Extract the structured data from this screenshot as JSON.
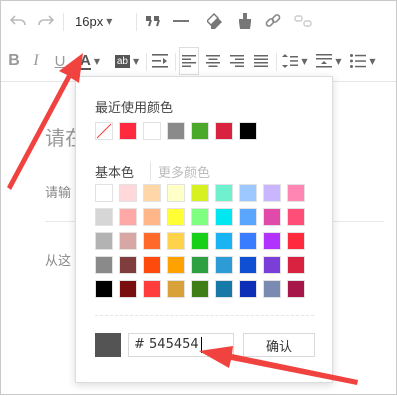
{
  "toolbar": {
    "font_size": "16px",
    "icons_row1": [
      "undo-icon",
      "redo-icon",
      "font-size-select",
      "quote-icon",
      "horizontal-rule-icon",
      "eraser-icon",
      "format-brush-icon",
      "link-icon",
      "unlink-icon"
    ],
    "icons_row2": [
      "bold-icon",
      "italic-icon",
      "underline-icon",
      "font-color-icon",
      "background-color-icon",
      "indent-icon",
      "align-left-icon",
      "align-center-icon",
      "align-right-icon",
      "justify-icon",
      "line-height-icon",
      "paragraph-spacing-icon",
      "list-icon"
    ]
  },
  "editor": {
    "title_placeholder": "请在",
    "line1_placeholder": "请输",
    "line2_placeholder": "从这"
  },
  "color_picker": {
    "recent_label": "最近使用颜色",
    "recent_colors": [
      "none",
      "#ff2a3d",
      "#ffffff",
      "#8a8a8a",
      "#4aa82a",
      "#d9223f",
      "#000000"
    ],
    "basic_label": "基本色",
    "more_label": "更多颜色",
    "basic_colors": [
      [
        "#ffffff",
        "#ffd9d9",
        "#ffd6a8",
        "#ffffc8",
        "#d7f01f",
        "#6ff0cf",
        "#9cc7ff",
        "#c9b6ff",
        "#ff86b3"
      ],
      [
        "#d6d6d6",
        "#ffa8a8",
        "#ffb78a",
        "#ffff33",
        "#7fff7f",
        "#00e7f2",
        "#5aa6ff",
        "#e04aa8",
        "#ff4f79"
      ],
      [
        "#b3b3b3",
        "#d9a6a6",
        "#ff6a2a",
        "#ffd24a",
        "#19d019",
        "#1ab4f4",
        "#3a7cff",
        "#b233ff",
        "#ff2a3d"
      ],
      [
        "#8a8a8a",
        "#7f3d3d",
        "#ff4a0d",
        "#ffa200",
        "#2ea041",
        "#2c9bd6",
        "#0f4fd3",
        "#7a3fd6",
        "#d9223f"
      ],
      [
        "#000000",
        "#7a0d0d",
        "#ff3d3d",
        "#d9a13a",
        "#3f7d17",
        "#1779a8",
        "#0d2fb8",
        "#7a8ab0",
        "#a8174a"
      ]
    ],
    "current_color": "#545454",
    "hex_value": "# 545454",
    "confirm_label": "确认"
  },
  "annotation": {
    "arrow_color": "#f0423f"
  }
}
